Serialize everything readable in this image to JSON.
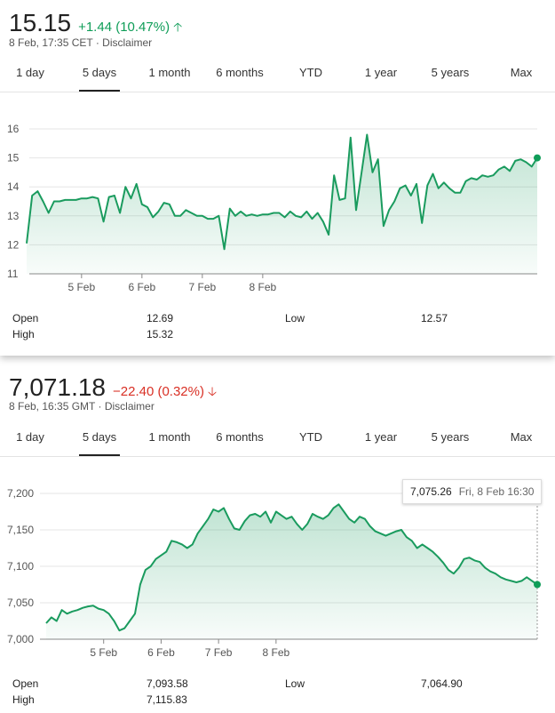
{
  "tabs": [
    "1 day",
    "5 days",
    "1 month",
    "6 months",
    "YTD",
    "1 year",
    "5 years",
    "Max"
  ],
  "colors": {
    "up": "#0f9d58",
    "down": "#d93025",
    "line": "#1a9b5e"
  },
  "quote1": {
    "price": "15.15",
    "change": "+1.44 (10.47%)",
    "direction": "up",
    "arrow_icon": "arrow-up-icon",
    "timestamp": "8 Feb, 17:35 CET",
    "disclaimer": "Disclaimer",
    "active_tab": "5 days",
    "stats": {
      "open_label": "Open",
      "open_value": "12.69",
      "low_label": "Low",
      "low_value": "12.57",
      "high_label": "High",
      "high_value": "15.32"
    }
  },
  "quote2": {
    "price": "7,071.18",
    "change": "−22.40 (0.32%)",
    "direction": "down",
    "arrow_icon": "arrow-down-icon",
    "timestamp": "8 Feb, 16:35 GMT",
    "disclaimer": "Disclaimer",
    "active_tab": "5 days",
    "tooltip": {
      "value": "7,075.26",
      "date": "Fri, 8 Feb 16:30"
    },
    "stats": {
      "open_label": "Open",
      "open_value": "7,093.58",
      "low_label": "Low",
      "low_value": "7,064.90",
      "high_label": "High",
      "high_value": "7,115.83"
    }
  },
  "chart_data": [
    {
      "type": "line",
      "title": "",
      "xlabel": "",
      "ylabel": "",
      "ylim": [
        11,
        16
      ],
      "yticks": [
        "11",
        "12",
        "13",
        "14",
        "15",
        "16"
      ],
      "xtick_labels": [
        "5 Feb",
        "6 Feb",
        "7 Feb",
        "8 Feb"
      ],
      "xtick_index": [
        10,
        21,
        32,
        43
      ],
      "grid": true,
      "series": [
        {
          "values": [
            12.05,
            13.7,
            13.85,
            13.5,
            13.1,
            13.5,
            13.5,
            13.55,
            13.55,
            13.55,
            13.6,
            13.6,
            13.65,
            13.6,
            12.8,
            13.65,
            13.7,
            13.1,
            14.0,
            13.6,
            14.1,
            13.4,
            13.3,
            12.95,
            13.15,
            13.45,
            13.4,
            13.0,
            13.0,
            13.2,
            13.1,
            13.0,
            13.0,
            12.9,
            12.9,
            13.0,
            11.85,
            13.25,
            13.0,
            13.15,
            13.0,
            13.05,
            13.0,
            13.05,
            13.05,
            13.1,
            13.1,
            12.95,
            13.15,
            13.0,
            12.95,
            13.15,
            12.9,
            13.1,
            12.8,
            12.35,
            14.4,
            13.55,
            13.6,
            15.7,
            13.2,
            14.5,
            15.8,
            14.5,
            14.95,
            12.65,
            13.2,
            13.5,
            13.95,
            14.05,
            13.7,
            14.1,
            12.75,
            14.05,
            14.45,
            13.95,
            14.15,
            13.95,
            13.8,
            13.8,
            14.2,
            14.3,
            14.25,
            14.4,
            14.35,
            14.4,
            14.6,
            14.7,
            14.55,
            14.9,
            14.95,
            14.85,
            14.7,
            15.0
          ]
        }
      ]
    },
    {
      "type": "line",
      "title": "",
      "xlabel": "",
      "ylabel": "",
      "ylim": [
        7000,
        7200
      ],
      "yticks": [
        "7,000",
        "7,050",
        "7,100",
        "7,150",
        "7,200"
      ],
      "xtick_labels": [
        "5 Feb",
        "6 Feb",
        "7 Feb",
        "8 Feb"
      ],
      "xtick_index": [
        11,
        22,
        33,
        44
      ],
      "grid": true,
      "series": [
        {
          "values": [
            7022,
            7030,
            7025,
            7040,
            7035,
            7038,
            7040,
            7043,
            7045,
            7046,
            7042,
            7040,
            7035,
            7025,
            7012,
            7015,
            7025,
            7035,
            7075,
            7095,
            7100,
            7110,
            7115,
            7120,
            7135,
            7133,
            7130,
            7125,
            7130,
            7145,
            7155,
            7165,
            7178,
            7175,
            7180,
            7165,
            7152,
            7150,
            7162,
            7170,
            7172,
            7168,
            7175,
            7160,
            7175,
            7170,
            7165,
            7168,
            7158,
            7150,
            7158,
            7172,
            7168,
            7165,
            7170,
            7180,
            7185,
            7175,
            7165,
            7160,
            7168,
            7165,
            7155,
            7148,
            7145,
            7142,
            7145,
            7148,
            7150,
            7140,
            7135,
            7125,
            7130,
            7125,
            7120,
            7113,
            7105,
            7095,
            7090,
            7098,
            7110,
            7112,
            7108,
            7106,
            7098,
            7093,
            7090,
            7085,
            7082,
            7080,
            7078,
            7080,
            7085,
            7080,
            7075
          ]
        }
      ]
    }
  ]
}
